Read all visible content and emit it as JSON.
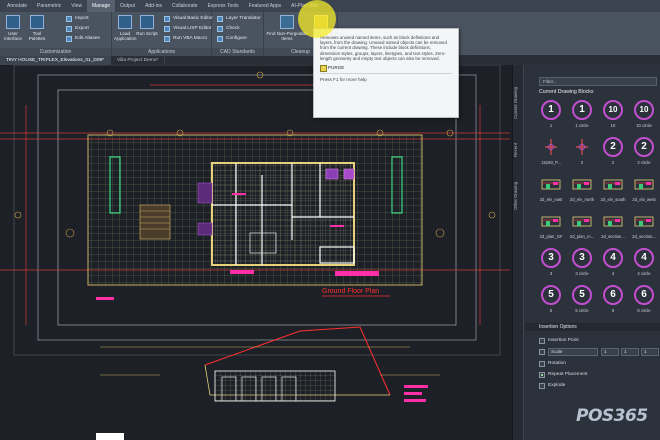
{
  "ribbon": {
    "tabs": [
      "Annotate",
      "Parametric",
      "View",
      "Manage",
      "Output",
      "Add-ins",
      "Collaborate",
      "Express Tools",
      "Featured Apps",
      "AI-Plan (Bit)"
    ],
    "active_tab": "Manage",
    "panels": {
      "customization": {
        "title": "Customization",
        "user_interface": "User Interface",
        "tool_palettes": "Tool Palettes",
        "import": "Import",
        "export": "Export",
        "edit_aliases": "Edit Aliases"
      },
      "applications": {
        "title": "Applications",
        "load_application": "Load Application",
        "run_script": "Run Script",
        "visual_basic_editor": "Visual Basic Editor",
        "visual_lisp_editor": "Visual LISP Editor",
        "run_vba_macro": "Run VBA Macro"
      },
      "cad_standards": {
        "title": "CAD Standards",
        "layer_translator": "Layer Translator",
        "check": "Check",
        "configure": "Configure"
      },
      "cleanup": {
        "title": "Cleanup",
        "find_nonpurgeable": "Find Non-Purgeable Items",
        "purge": "Purge"
      }
    }
  },
  "file_tabs": [
    "TINY HOUSE_TRIPLEX_Elevations_01_D09*",
    "Villa Project Demo*"
  ],
  "drawing": {
    "plan_label": "Ground Floor Plan"
  },
  "tooltip": {
    "description": "Removes unused named items, such as block definitions and layers, from the drawing. Unused named objects can be removed from the current drawing. These include block definitions, dimension styles, groups, layers, linetypes, and text styles. Zero-length geometry and empty text objects can also be removed.",
    "command": "PURGE",
    "help": "Press F1 for more help"
  },
  "palette": {
    "vertical_tabs": [
      "Current Drawing",
      "Recent",
      "Other Drawing"
    ],
    "filter_placeholder": "Filter...",
    "section_title": "Current Drawing Blocks",
    "blocks": [
      {
        "label": "1",
        "thumb": "1",
        "kind": "circle"
      },
      {
        "label": "1 circle",
        "thumb": "1",
        "kind": "circle"
      },
      {
        "label": "10",
        "thumb": "10",
        "kind": "circle"
      },
      {
        "label": "10 circle",
        "thumb": "10",
        "kind": "circle"
      },
      {
        "label": "15160_P...",
        "thumb": "",
        "kind": "symbol"
      },
      {
        "label": "2",
        "thumb": "",
        "kind": "symbol"
      },
      {
        "label": "2",
        "thumb": "2",
        "kind": "circle"
      },
      {
        "label": "2 circle",
        "thumb": "2",
        "kind": "circle"
      },
      {
        "label": "2d_elv_east",
        "thumb": "",
        "kind": "drawing"
      },
      {
        "label": "2d_elv_north",
        "thumb": "",
        "kind": "drawing"
      },
      {
        "label": "2d_elv_south",
        "thumb": "",
        "kind": "drawing"
      },
      {
        "label": "2d_elv_west",
        "thumb": "",
        "kind": "drawing"
      },
      {
        "label": "2d_plan_GF",
        "thumb": "",
        "kind": "drawing"
      },
      {
        "label": "2d_plan_m...",
        "thumb": "",
        "kind": "drawing"
      },
      {
        "label": "2d_section...",
        "thumb": "",
        "kind": "drawing"
      },
      {
        "label": "2d_section...",
        "thumb": "",
        "kind": "drawing"
      },
      {
        "label": "3",
        "thumb": "3",
        "kind": "circle"
      },
      {
        "label": "3 circle",
        "thumb": "3",
        "kind": "circle"
      },
      {
        "label": "4",
        "thumb": "4",
        "kind": "circle"
      },
      {
        "label": "4 circle",
        "thumb": "4",
        "kind": "circle"
      },
      {
        "label": "5",
        "thumb": "5",
        "kind": "circle"
      },
      {
        "label": "5 circle",
        "thumb": "5",
        "kind": "circle"
      },
      {
        "label": "6",
        "thumb": "6",
        "kind": "circle"
      },
      {
        "label": "6 circle",
        "thumb": "6",
        "kind": "circle"
      }
    ],
    "insertion_options": {
      "title": "Insertion Options",
      "insertion_point": "Insertion Point",
      "scale_label": "Scale",
      "scale_values": [
        "1",
        "1",
        "1"
      ],
      "rotation": "Rotation",
      "repeat_placement": "Repeat Placement",
      "explode": "Explode"
    }
  },
  "watermark": "POS365",
  "colors": {
    "purge_highlight": "#f5eb28",
    "block_circle": "#c44ed0",
    "plan_label": "#ff3030"
  }
}
